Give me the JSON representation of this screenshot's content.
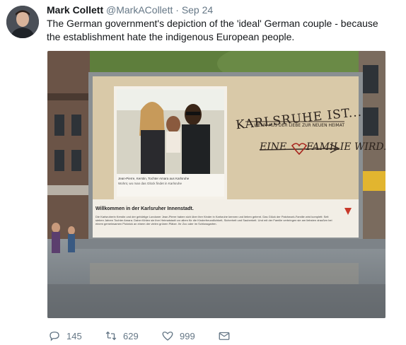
{
  "tweet": {
    "display_name": "Mark Collett",
    "handle": "@MarkACollett",
    "separator": "·",
    "date": "Sep 24",
    "text": "The German government's depiction of the 'ideal' German couple - because the establishment hate the indigenous European people."
  },
  "billboard": {
    "headline": "KARLSRUHE IST...",
    "subline": "WENN AUS DER LIEBE ZUR NEUEN HEIMAT",
    "tagline_left": "EINE",
    "tagline_right": "FAMILIE WIRD.",
    "photo_caption_1": "Jean-Pierre, Kerstin, Tochter Amara aus Karlsruhe",
    "photo_caption_2": "Wohnt, wo man das Glück findet in Karlsruhe",
    "welcome": "Willkommen in der Karlsruher Innenstadt.",
    "body_text": "Die Karlsruherin Kerstin und der gebürtige Londoner Jean-Pierre haben sich über ihre Kinder in Karlsruhe kennen und lieben gelernt. Das Glück der Patchwork-Familie wird komplett: Seit sieben Jahren Tochter Amara. Daher fühlen sie ihre Heimatstadt vor allem für die Kinderfreundlichkeit, Sicherheit und Sauberkeit. Und mit der Familie verbringen sie am liebsten draußen bei einem gemeinsamen Picknick an einem der vielen grünen Plätze. Ihr Zoo oder im Schlossgarten."
  },
  "actions": {
    "replies": "145",
    "retweets": "629",
    "likes": "999"
  },
  "colors": {
    "text": "#14171a",
    "muted": "#657786",
    "billboard_bg": "#d9c9a8",
    "arrow": "#a8261f"
  }
}
